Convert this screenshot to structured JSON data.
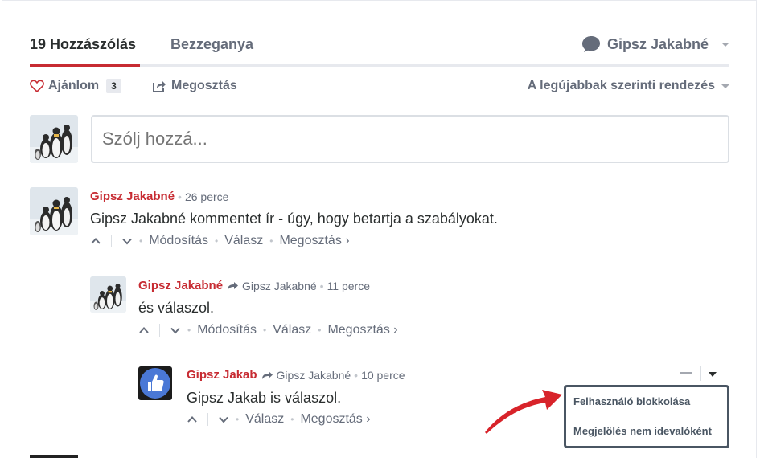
{
  "nav": {
    "tab_comments": "19 Hozzászólás",
    "tab_community": "Bezzeganya",
    "user_name": "Gipsz Jakabné"
  },
  "toolbar": {
    "recommend_label": "Ajánlom",
    "recommend_count": "3",
    "share_label": "Megosztás",
    "sort_label": "A legújabbak szerinti rendezés"
  },
  "composer": {
    "placeholder": "Szólj hozzá..."
  },
  "comments": [
    {
      "author": "Gipsz Jakabné",
      "time": "26 perce",
      "body": "Gipsz Jakabné kommentet ír - úgy, hogy betartja a szabályokat.",
      "actions": [
        "Módosítás",
        "Válasz",
        "Megosztás ›"
      ]
    },
    {
      "author": "Gipsz Jakabné",
      "reply_to": "Gipsz Jakabné",
      "time": "11 perce",
      "body": "és válaszol.",
      "actions": [
        "Módosítás",
        "Válasz",
        "Megosztás ›"
      ]
    },
    {
      "author": "Gipsz Jakab",
      "reply_to": "Gipsz Jakabné",
      "time": "10 perce",
      "body": "Gipsz Jakab is válaszol.",
      "actions": [
        "Válasz",
        "Megosztás ›"
      ]
    }
  ],
  "comment_menu": {
    "items": [
      "Felhasználó blokkolása",
      "Megjelölés nem idevalóként"
    ]
  },
  "colors": {
    "accent": "#c72b32",
    "text": "#2a2e2e",
    "muted": "#656c7a",
    "annotation_arrow": "#d8232a",
    "facebook_blue": "#4a78d6"
  }
}
